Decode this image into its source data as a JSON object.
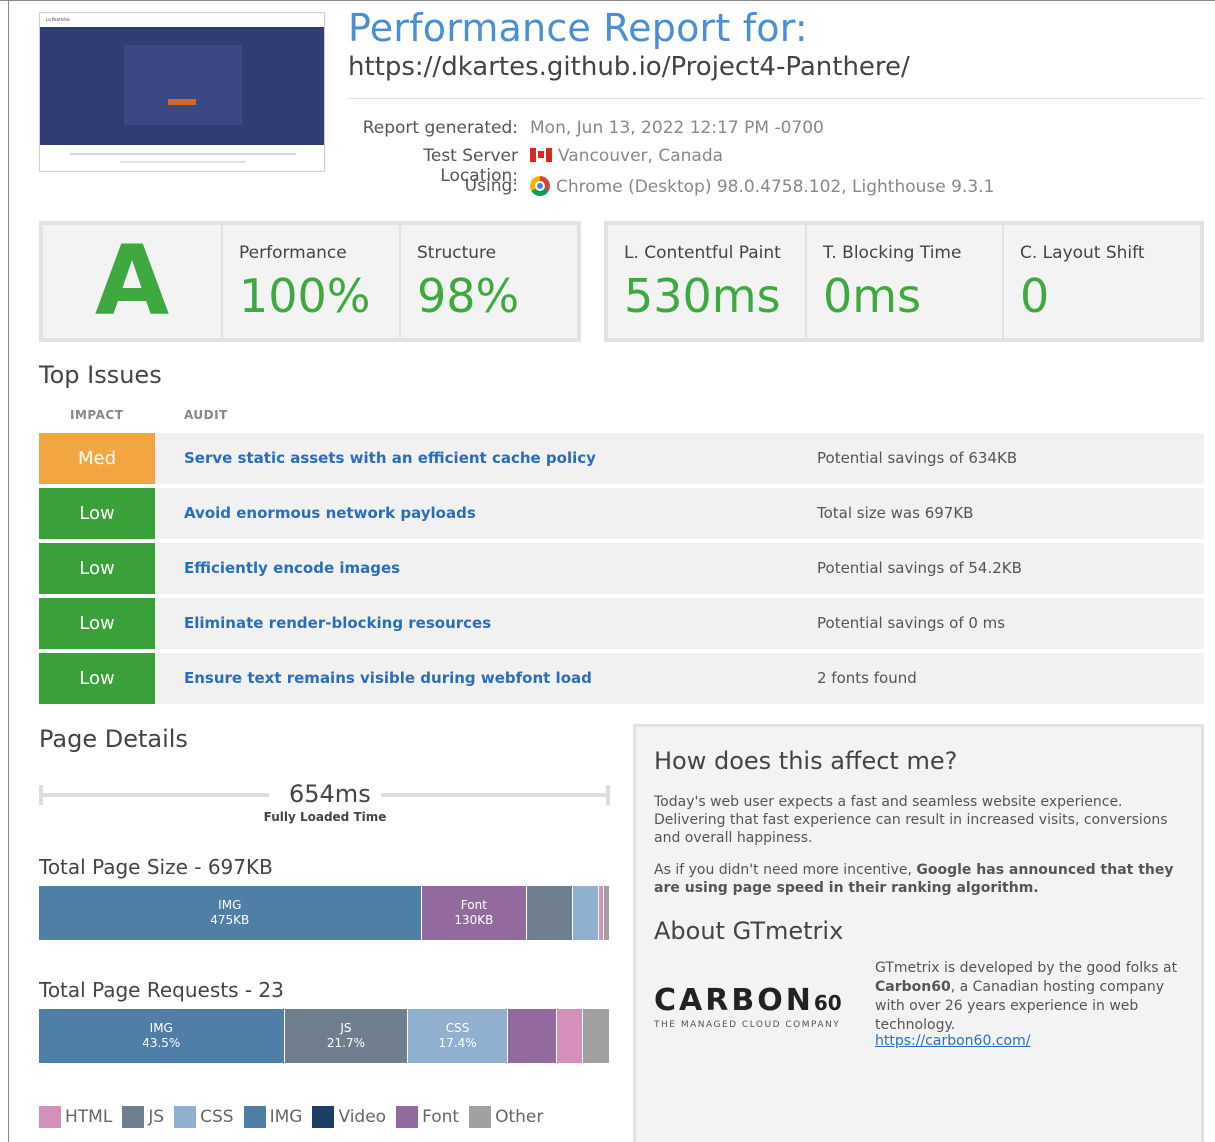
{
  "header": {
    "title": "Performance Report for:",
    "url": "https://dkartes.github.io/Project4-Panthere/",
    "thumbnail": {
      "site_name": "La Panthère"
    },
    "meta": [
      {
        "label": "Report generated:",
        "value": "Mon, Jun 13, 2022 12:17 PM -0700",
        "icon": ""
      },
      {
        "label": "Test Server Location:",
        "value": "Vancouver, Canada",
        "icon": "canada-flag-icon"
      },
      {
        "label": "Using:",
        "value": "Chrome (Desktop) 98.0.4758.102, Lighthouse 9.3.1",
        "icon": "chrome-icon"
      }
    ]
  },
  "scores": {
    "grade": "A",
    "performance": {
      "label": "Performance",
      "value": "100%"
    },
    "structure": {
      "label": "Structure",
      "value": "98%"
    },
    "lcp": {
      "label": "L. Contentful Paint",
      "value": "530ms"
    },
    "tbt": {
      "label": "T. Blocking Time",
      "value": "0ms"
    },
    "cls": {
      "label": "C. Layout Shift",
      "value": "0"
    }
  },
  "top_issues": {
    "heading": "Top Issues",
    "col_impact": "IMPACT",
    "col_audit": "AUDIT",
    "rows": [
      {
        "impact": "Med",
        "audit": "Serve static assets with an efficient cache policy",
        "detail": "Potential savings of 634KB"
      },
      {
        "impact": "Low",
        "audit": "Avoid enormous network payloads",
        "detail": "Total size was 697KB"
      },
      {
        "impact": "Low",
        "audit": "Efficiently encode images",
        "detail": "Potential savings of 54.2KB"
      },
      {
        "impact": "Low",
        "audit": "Eliminate render-blocking resources",
        "detail": "Potential savings of 0 ms"
      },
      {
        "impact": "Low",
        "audit": "Ensure text remains visible during webfont load",
        "detail": "2 fonts found"
      }
    ]
  },
  "page_details": {
    "heading": "Page Details",
    "fully_loaded_value": "654ms",
    "fully_loaded_label": "Fully Loaded Time",
    "size_heading": "Total Page Size - 697KB",
    "size_segments": [
      {
        "type": "IMG",
        "value": "475KB",
        "share": 0.67
      },
      {
        "type": "Font",
        "value": "130KB",
        "share": 0.185
      },
      {
        "type": "JS",
        "value": "",
        "share": 0.08
      },
      {
        "type": "CSS",
        "value": "",
        "share": 0.045
      },
      {
        "type": "HTML",
        "value": "",
        "share": 0.01
      },
      {
        "type": "Other",
        "value": "",
        "share": 0.01
      }
    ],
    "requests_heading": "Total Page Requests - 23",
    "request_segments": [
      {
        "type": "IMG",
        "value": "43.5%",
        "share": 0.43
      },
      {
        "type": "JS",
        "value": "21.7%",
        "share": 0.217
      },
      {
        "type": "CSS",
        "value": "17.4%",
        "share": 0.174
      },
      {
        "type": "Font",
        "value": "",
        "share": 0.087
      },
      {
        "type": "HTML",
        "value": "",
        "share": 0.045
      },
      {
        "type": "Other",
        "value": "",
        "share": 0.047
      }
    ],
    "legend": [
      {
        "label": "HTML",
        "color": "#d48fba"
      },
      {
        "label": "JS",
        "color": "#6f7f8f"
      },
      {
        "label": "CSS",
        "color": "#8fb0cf"
      },
      {
        "label": "IMG",
        "color": "#4f7ea6"
      },
      {
        "label": "Video",
        "color": "#1c3f66"
      },
      {
        "label": "Font",
        "color": "#936a9e"
      },
      {
        "label": "Other",
        "color": "#a0a0a0"
      }
    ]
  },
  "info": {
    "heading1": "How does this affect me?",
    "para1": "Today's web user expects a fast and seamless website experience. Delivering that fast experience can result in increased visits, conversions and overall happiness.",
    "para2_start": "As if you didn't need more incentive, ",
    "para2_bold": "Google has announced that they are using page speed in their ranking algorithm.",
    "heading2": "About GTmetrix",
    "carbon_word": "CARBON",
    "carbon_num": "60",
    "carbon_tag": "THE MANAGED CLOUD COMPANY",
    "desc_start": "GTmetrix is developed by the good folks at ",
    "desc_bold": "Carbon60",
    "desc_end": ", a Canadian hosting company with over 26 years experience in web technology.",
    "link": "https://carbon60.com/"
  },
  "colors": {
    "green": "#3ea93e",
    "med": "#f2a641",
    "low": "#3aa13a",
    "title_blue": "#4a8fd4",
    "link_blue": "#2a6ebb"
  }
}
